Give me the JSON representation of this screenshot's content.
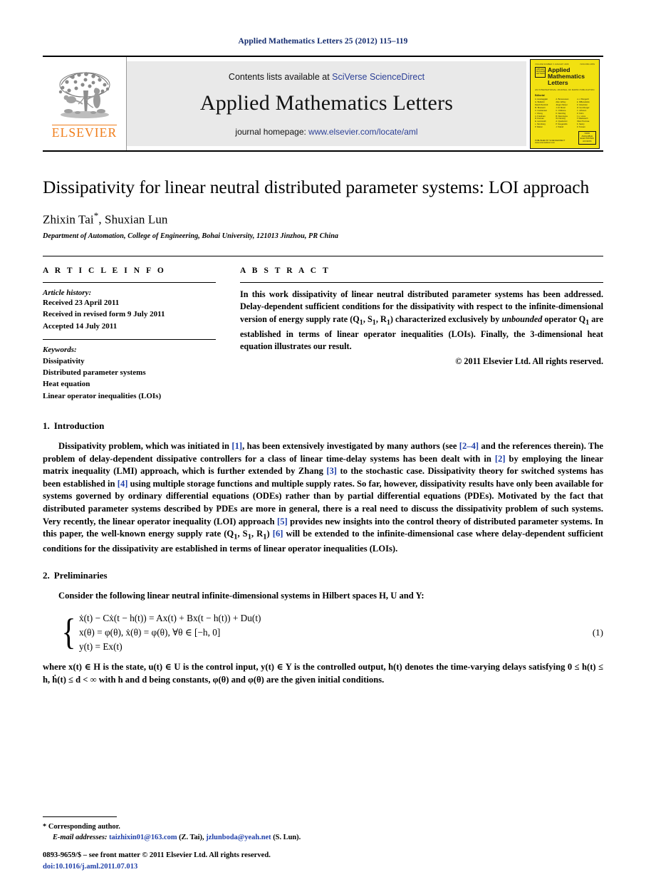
{
  "running_head": "Applied Mathematics Letters 25 (2012) 115–119",
  "masthead": {
    "publisher_name": "ELSEVIER",
    "contents_prefix": "Contents lists available at ",
    "contents_link": "SciVerse ScienceDirect",
    "journal_name": "Applied Mathematics Letters",
    "homepage_prefix": "journal homepage: ",
    "homepage_link": "www.elsevier.com/locate/aml",
    "cover": {
      "issue_line_left": "VOLUME NUMBER X  JANUARY 2008",
      "issue_line_right": "ISSN 0893-9659",
      "mark_text": "APPLIED MATHEMATICS LETTERS",
      "title_line1": "Applied",
      "title_line2": "Mathematics",
      "title_line3": "Letters",
      "subtitle": "AN INTERNATIONAL JOURNAL OF RAPID PUBLICATION",
      "editorial_label": "Editorial",
      "columns": [
        [
          "A. Avantaggiati",
          "G. Bellettini",
          "David Mumford",
          "M. Bramanti",
          "C. Carstensen",
          "J. Cheng",
          "A. Friedman",
          "R. Kannan",
          "E. Lanconelli",
          "L. Nirenberg",
          "P. Rabier"
        ],
        [
          "A. Bensoussan",
          "Alan Jeffrey",
          "Jürgen Moser",
          "J.-M. Morel",
          "C. Chidume",
          "K. Deimling",
          "B. Dacorogna",
          "W. Fleming",
          "A. Quarteroni",
          "P. Souganidis",
          "J. Toland"
        ],
        [
          "H.-J. Bungartz",
          "E. DiBenedetto",
          "R. Glowinski",
          "M. Gunzburger",
          "C. Johnson",
          "R. Kohn",
          "J.-L. Lions",
          "P. Markowich",
          "Oliver Penrose",
          "S. Sastry",
          "R. Temam"
        ]
      ],
      "foot_text": "PUBLISHED BY SCIENCEDIRECT www.sciencedirect.com",
      "badge_line1": "NOW AVAILABLE",
      "badge_line2": "ELECTRONIC",
      "badge_line3": "ACCESS"
    }
  },
  "article": {
    "title": "Dissipativity for linear neutral distributed parameter systems: LOI approach",
    "authors": "Zhixin Tai",
    "author_star": "*",
    "authors_rest": ", Shuxian Lun",
    "affiliation": "Department of Automation, College of Engineering, Bohai University, 121013 Jinzhou, PR China"
  },
  "article_info": {
    "label": "A R T I C L E   I N F O",
    "history_title": "Article history:",
    "history": [
      "Received 23 April 2011",
      "Received in revised form 9 July 2011",
      "Accepted 14 July 2011"
    ],
    "keywords_title": "Keywords:",
    "keywords": [
      "Dissipativity",
      "Distributed parameter systems",
      "Heat equation",
      "Linear operator inequalities (LOIs)"
    ]
  },
  "abstract": {
    "label": "A B S T R A C T",
    "text_part1": "In this work dissipativity of linear neutral distributed parameter systems has been addressed. Delay-dependent sufficient conditions for the dissipativity with respect to the infinite-dimensional version of energy supply rate (Q",
    "sub1": "1",
    "text_part2": ", S",
    "sub2": "1",
    "text_part3": ", R",
    "sub3": "1",
    "text_part4": ") characterized exclusively by ",
    "italic_word": "unbounded",
    "text_part5": " operator Q",
    "sub4": "1",
    "text_part6": " are established in terms of linear operator inequalities (LOIs). Finally, the 3-dimensional heat equation illustrates our result.",
    "copyright": "© 2011 Elsevier Ltd. All rights reserved."
  },
  "sections": {
    "intro": {
      "number": "1.",
      "title": "Introduction",
      "p1_a": "Dissipativity problem, which was initiated in ",
      "cite1": "[1]",
      "p1_b": ", has been extensively investigated by many authors (see ",
      "cite2": "[2–4]",
      "p1_c": " and the references therein). The problem of delay-dependent dissipative controllers for a class of linear time-delay systems has been dealt with in ",
      "cite3": "[2]",
      "p1_d": " by employing the linear matrix inequality (LMI) approach, which is further extended by Zhang ",
      "cite4": "[3]",
      "p1_e": " to the stochastic case. Dissipativity theory for switched systems has been established in ",
      "cite5": "[4]",
      "p1_f": " using multiple storage functions and multiple supply rates. So far, however, dissipativity results have only been available for systems governed by ordinary differential equations (ODEs) rather than by partial differential equations (PDEs). Motivated by the fact that distributed parameter systems described by PDEs are more in general, there is a real need to discuss the dissipativity problem of such systems. Very recently, the linear operator inequality (LOI) approach ",
      "cite6": "[5]",
      "p1_g": " provides new insights into the control theory of distributed parameter systems. In this paper, the well-known energy supply rate (Q",
      "p1_h": ", S",
      "p1_i": ", R",
      "p1_j": ") ",
      "cite7": "[6]",
      "p1_k": " will be extended to the infinite-dimensional case where delay-dependent sufficient conditions for the dissipativity are established in terms of linear operator inequalities (LOIs)."
    },
    "prelim": {
      "number": "2.",
      "title": "Preliminaries",
      "lead": "Consider the following linear neutral infinite-dimensional systems in Hilbert spaces H, U and Y:",
      "equation": {
        "line1": "ẋ(t) − Cẋ(t − h(t)) = Ax(t) + Bx(t − h(t)) + Du(t)",
        "line2": "x(θ) = φ(θ),        ẋ(θ) = φ(θ),    ∀θ ∈ [−h, 0]",
        "line3": "y(t) = Ex(t)",
        "number": "(1)"
      },
      "where_text": "where x(t) ∈ H is the state, u(t) ∈ U is the control input, y(t) ∈ Y is the controlled output, h(t) denotes the time-varying delays satisfying 0 ≤ h(t) ≤ h, ḣ(t) ≤ d < ∞ with h and d being constants, φ(θ) and φ(θ) are the given initial conditions."
    }
  },
  "footnote": {
    "star": "*",
    "corresponding": "Corresponding author.",
    "email_label": "E-mail addresses:",
    "email1": "taizhixin01@163.com",
    "email1_who": "(Z. Tai),",
    "email2": "jzlunboda@yeah.net",
    "email2_who": "(S. Lun)."
  },
  "page_footer": {
    "line1": "0893-9659/$ – see front matter © 2011 Elsevier Ltd. All rights reserved.",
    "doi": "doi:10.1016/j.aml.2011.07.013"
  },
  "colors": {
    "running_head": "#122a6e",
    "link_blue": "#2b3f96",
    "cite_blue": "#1f3fa8",
    "elsevier_orange": "#f07d1a",
    "banner_gray": "#e9e9e9",
    "cover_yellow": "#f2e111"
  }
}
